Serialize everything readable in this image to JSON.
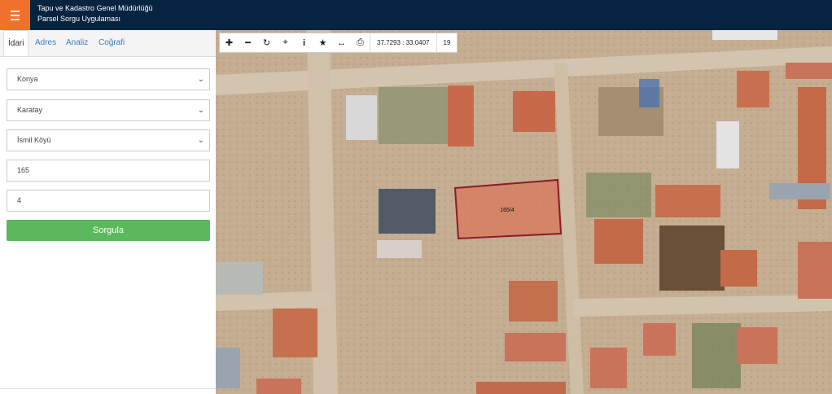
{
  "header": {
    "line1": "Tapu ve Kadastro Genel Müdürlüğü",
    "line2": "Parsel Sorgu Uygulaması",
    "menu_icon": "hamburger-icon",
    "accent": "#f0712d",
    "bg": "#06233f"
  },
  "tabs": [
    {
      "label": "İdari",
      "active": true
    },
    {
      "label": "Adres"
    },
    {
      "label": "Analiz"
    },
    {
      "label": "Coğrafi"
    }
  ],
  "form": {
    "province": "Konya",
    "district": "Karatay",
    "neighborhood": "İsmil Köyü",
    "block": "165",
    "parcel": "4",
    "submit_label": "Sorgula",
    "submit_color": "#5cb85c"
  },
  "map": {
    "toolbar_icons": [
      "zoom-in-icon",
      "zoom-out-icon",
      "refresh-icon",
      "locate-icon",
      "info-icon",
      "star-icon",
      "measure-icon",
      "print-icon"
    ],
    "coordinates": "37.7293 : 33.0407",
    "zoom": "19",
    "parcel_label": "165/4",
    "parcel_color": "#8b1a2b"
  }
}
